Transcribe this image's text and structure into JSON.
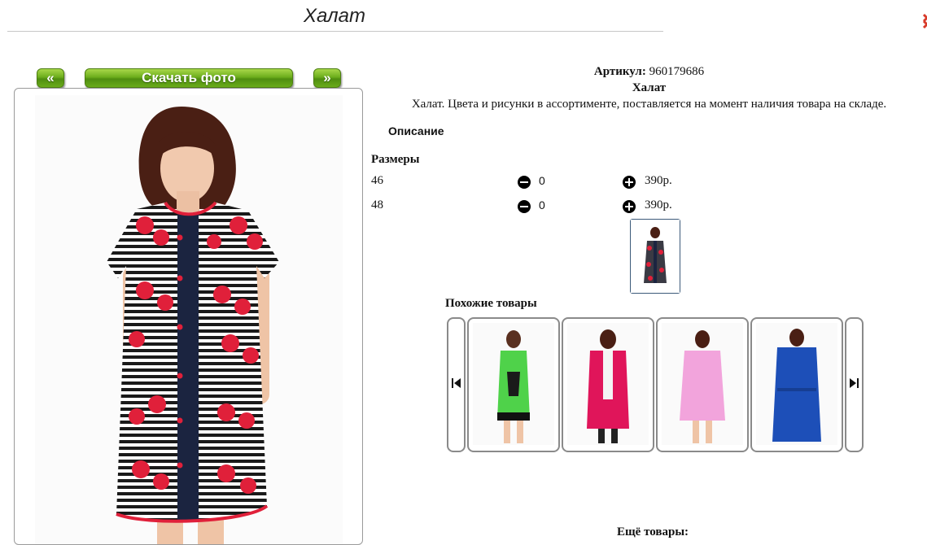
{
  "header": {
    "title": "Халат"
  },
  "photo_nav": {
    "prev_label": "«",
    "download_label": "Скачать фото",
    "next_label": "»"
  },
  "product": {
    "article_label": "Артикул:",
    "article_value": "960179686",
    "name": "Халат",
    "description": "Халат. Цвета и рисунки в ассортименте, поставляется на момент наличия товара на складе.",
    "description_heading": "Описание",
    "sizes_heading": "Размеры",
    "sizes": [
      {
        "size": "46",
        "qty": "0",
        "price": "390р."
      },
      {
        "size": "48",
        "qty": "0",
        "price": "390р."
      }
    ]
  },
  "similar": {
    "heading": "Похожие товары",
    "items": [
      "green-dress",
      "pink-robe",
      "light-pink-robe",
      "blue-robe"
    ]
  },
  "more": {
    "heading": "Ещё товары:"
  },
  "colors": {
    "button_green": "#6cad1c",
    "accent_red": "#e0203a",
    "robe_navy": "#1b2440"
  },
  "icons": [
    "close-icon",
    "minus-icon",
    "plus-icon",
    "skip-back-icon",
    "skip-forward-icon"
  ]
}
